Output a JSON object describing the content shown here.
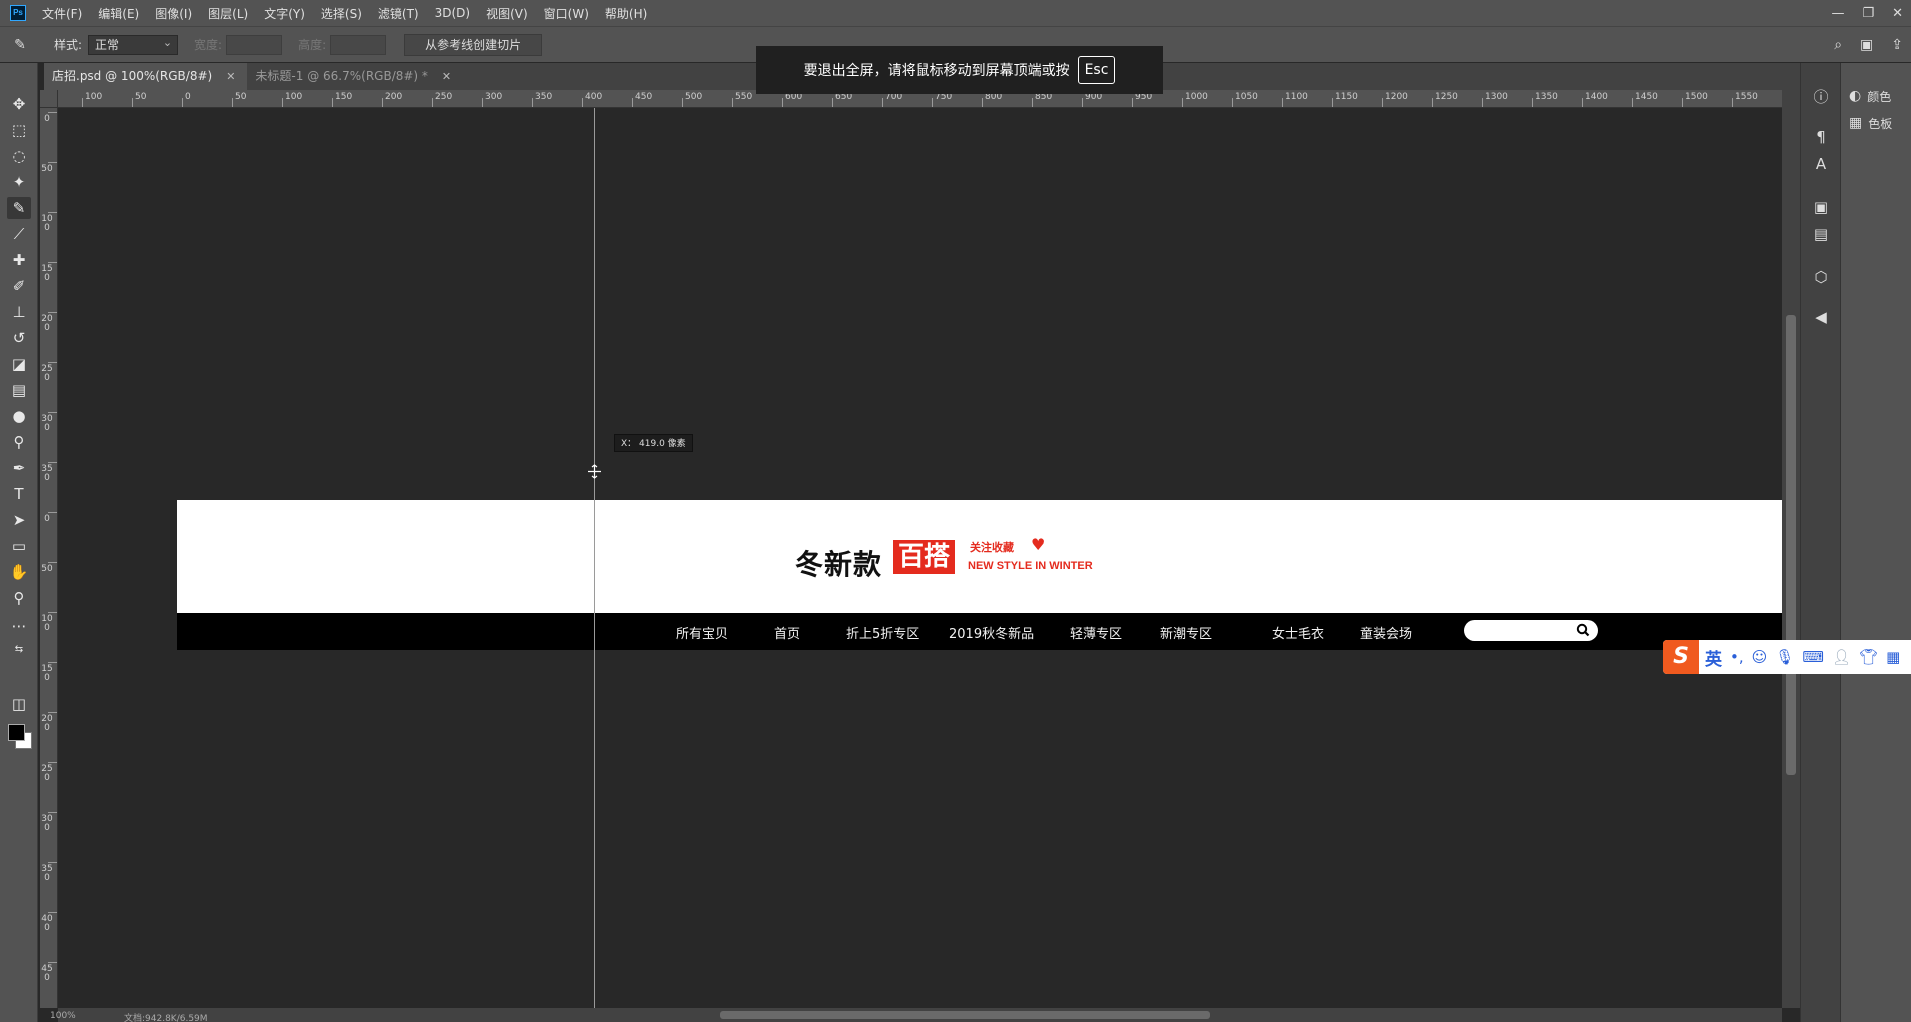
{
  "app": {
    "logo_text": "Ps",
    "menu": [
      "文件(F)",
      "编辑(E)",
      "图像(I)",
      "图层(L)",
      "文字(Y)",
      "选择(S)",
      "滤镜(T)",
      "3D(D)",
      "视图(V)",
      "窗口(W)",
      "帮助(H)"
    ],
    "window_controls": [
      "—",
      "❐",
      "✕"
    ]
  },
  "options_bar": {
    "style_label": "样式:",
    "style_value": "正常",
    "width_label": "宽度:",
    "height_label": "高度:",
    "slice_button": "从参考线创建切片"
  },
  "toast": {
    "message": "要退出全屏，请将鼠标移动到屏幕顶端或按",
    "key": "Esc"
  },
  "tabs": [
    {
      "label": "店招.psd @ 100%(RGB/8#)",
      "close": "✕"
    },
    {
      "label": "未标题-1 @ 66.7%(RGB/8#) *",
      "close": "✕"
    }
  ],
  "ruler": {
    "top_labels": [
      "100",
      "50",
      "0",
      "50",
      "100",
      "150",
      "200",
      "250",
      "300",
      "350",
      "400",
      "450",
      "500",
      "550",
      "600",
      "650",
      "700",
      "750",
      "800",
      "850",
      "900",
      "950",
      "1000",
      "1050",
      "1100",
      "1150",
      "1200",
      "1250",
      "1300",
      "1350",
      "1400",
      "1450",
      "1500",
      "1550"
    ],
    "left_labels": [
      "0",
      "5 0",
      "1 0 0",
      "1 5 0",
      "2 0 0",
      "2 5 0",
      "3 0 0",
      "3 5 0",
      "0",
      "5 0",
      "1 0 0",
      "1 5 0",
      "2 0 0",
      "2 5 0",
      "3 0 0",
      "3 5 0",
      "4 0 0",
      "4 5 0"
    ]
  },
  "guide_tooltip": "X： 419.0 像素",
  "banner": {
    "title": "冬新款",
    "tag": "百搭",
    "favorite": "关注收藏",
    "heart": "♥",
    "subtitle": "NEW STYLE IN WINTER",
    "nav": [
      "所有宝贝",
      "首页",
      "折上5折专区",
      "2019秋冬新品",
      "轻薄专区",
      "新潮专区",
      "女士毛衣",
      "童装会场"
    ],
    "colors": {
      "accent": "#e42b1e",
      "nav_bg": "#000000",
      "top_bg": "#ffffff"
    }
  },
  "ime": {
    "logo": "S",
    "lang": "英",
    "icons": [
      "punctuation-icon",
      "emoji-icon",
      "microphone-icon",
      "keyboard-icon",
      "user-icon",
      "shirt-icon",
      "grid-icon"
    ]
  },
  "status": {
    "zoom": "100%",
    "doc": "文档:942.8K/6.59M"
  },
  "right_panel": {
    "items": [
      "颜色",
      "色板"
    ]
  }
}
